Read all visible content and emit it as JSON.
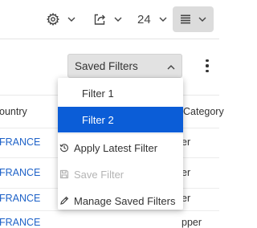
{
  "toolbar": {
    "page_size": "24",
    "icons": [
      "gear-icon",
      "export-icon",
      "list-view-icon",
      "chevron-down-icon"
    ]
  },
  "filter_bar": {
    "saved_filters_label": "Saved Filters",
    "icons": [
      "chevron-up-icon",
      "more-vertical-icon"
    ]
  },
  "table": {
    "headers": {
      "country": "ountry",
      "category": "Category"
    },
    "rows": [
      {
        "country": "FRANCE",
        "right": "er"
      },
      {
        "country": "FRANCE",
        "right": "er"
      },
      {
        "country": "FRANCE",
        "right": "er"
      },
      {
        "country": "FRANCE",
        "right": "pper"
      }
    ]
  },
  "dropdown": {
    "items": [
      {
        "label": "Filter 1",
        "selected": false,
        "disabled": false
      },
      {
        "label": "Filter 2",
        "selected": true,
        "disabled": false
      },
      {
        "label": "Apply Latest Filter",
        "icon": "history-icon",
        "disabled": false
      },
      {
        "label": "Save Filter",
        "icon": "save-icon",
        "disabled": true
      },
      {
        "label": "Manage Saved Filters",
        "icon": "pencil-icon",
        "disabled": false
      }
    ]
  },
  "colors": {
    "selected_bg": "#0b5dd7",
    "link": "#1f63c8",
    "disabled_text": "#b4b4b4",
    "active_toolbar_bg": "#dcdcdc"
  }
}
